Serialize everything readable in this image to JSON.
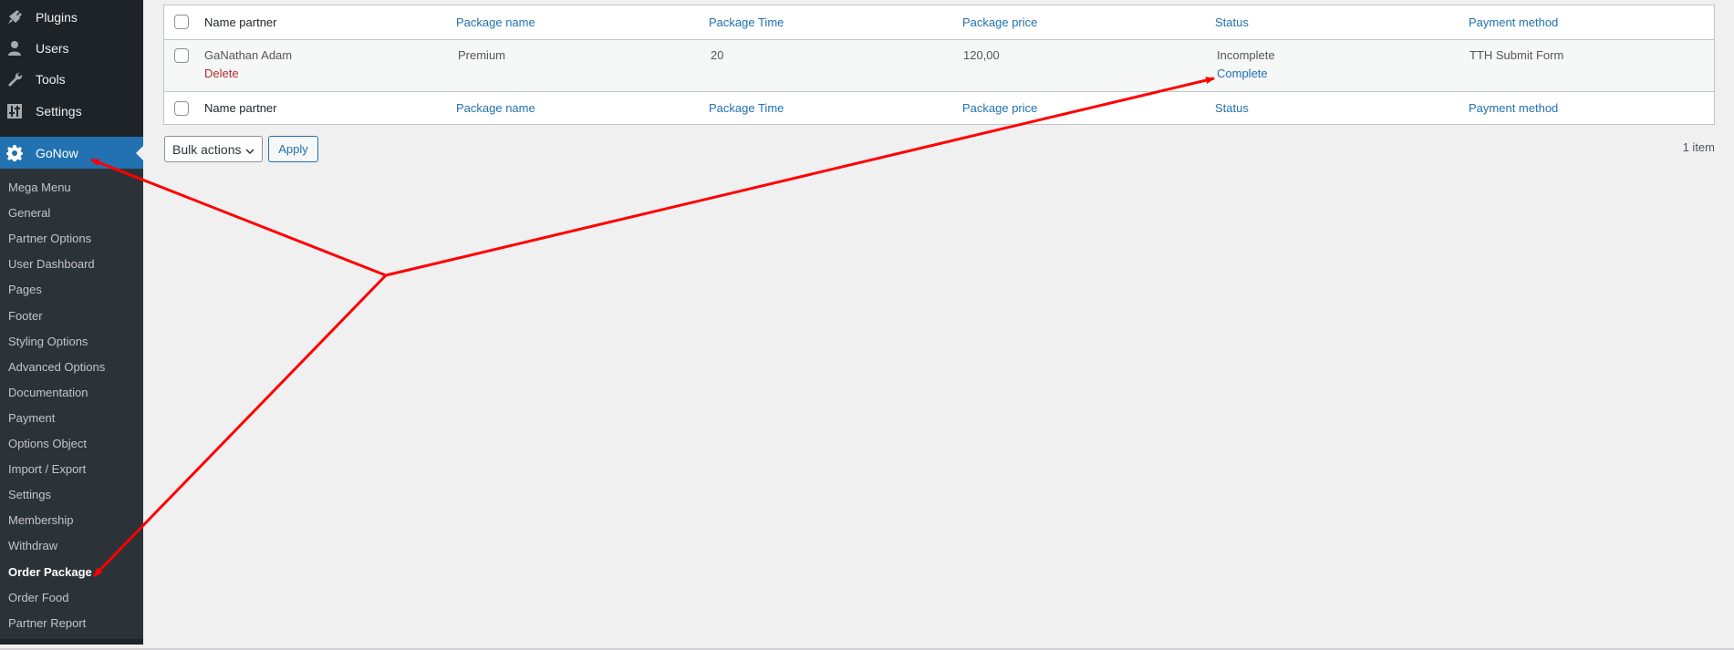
{
  "sidebar": {
    "top_items": [
      {
        "label": "Plugins",
        "icon": "plugin-icon"
      },
      {
        "label": "Users",
        "icon": "user-icon"
      },
      {
        "label": "Tools",
        "icon": "wrench-icon"
      },
      {
        "label": "Settings",
        "icon": "settings-sliders-icon"
      }
    ],
    "active_item": {
      "label": "GoNow",
      "icon": "gear-icon"
    },
    "submenu": [
      {
        "label": "Mega Menu"
      },
      {
        "label": "General"
      },
      {
        "label": "Partner Options"
      },
      {
        "label": "User Dashboard"
      },
      {
        "label": "Pages"
      },
      {
        "label": "Footer"
      },
      {
        "label": "Styling Options"
      },
      {
        "label": "Advanced Options"
      },
      {
        "label": "Documentation"
      },
      {
        "label": "Payment"
      },
      {
        "label": "Options Object"
      },
      {
        "label": "Import / Export"
      },
      {
        "label": "Settings"
      },
      {
        "label": "Membership"
      },
      {
        "label": "Withdraw"
      },
      {
        "label": "Order Package",
        "current": true
      },
      {
        "label": "Order Food"
      },
      {
        "label": "Partner Report"
      }
    ]
  },
  "table": {
    "columns": [
      "Name partner",
      "Package name",
      "Package Time",
      "Package price",
      "Status",
      "Payment method"
    ],
    "rows": [
      {
        "name_partner": "GaNathan Adam",
        "row_action": "Delete",
        "package_name": "Premium",
        "package_time": "20",
        "package_price": "120,00",
        "status": "Incomplete",
        "status_action": "Complete",
        "payment_method": "TTH Submit Form"
      }
    ]
  },
  "bulk_actions": {
    "selected": "Bulk actions",
    "apply_label": "Apply"
  },
  "item_count": "1 item",
  "annotation": {
    "color": "#ff0000"
  }
}
